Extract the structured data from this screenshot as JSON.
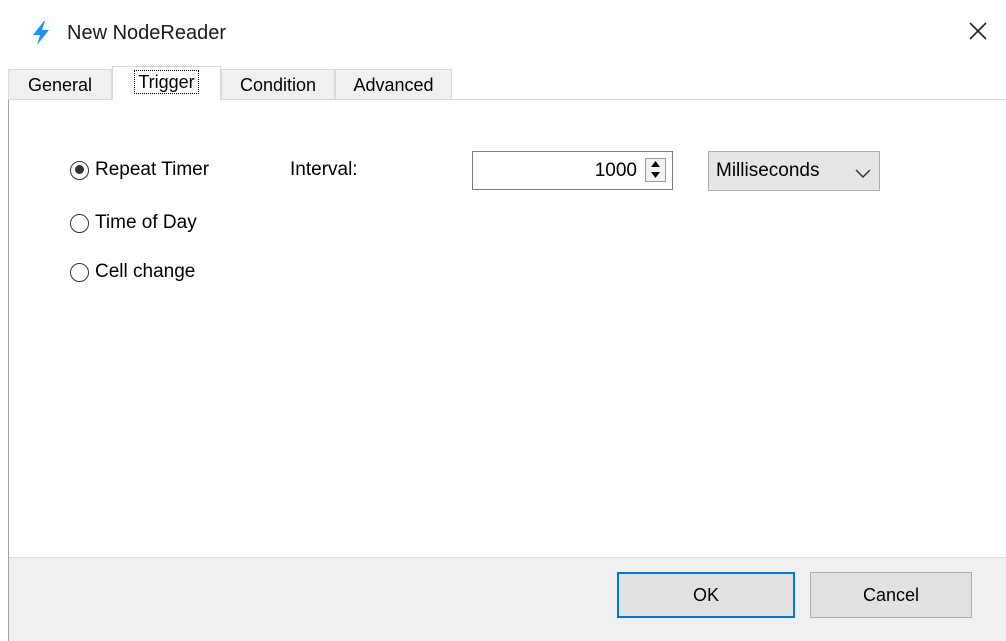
{
  "window": {
    "title": "New NodeReader",
    "icon": "lightning-bolt-icon",
    "close_icon": "close-icon"
  },
  "tabs": [
    {
      "label": "General",
      "active": false
    },
    {
      "label": "Trigger",
      "active": true
    },
    {
      "label": "Condition",
      "active": false
    },
    {
      "label": "Advanced",
      "active": false
    }
  ],
  "trigger": {
    "options": [
      {
        "label": "Repeat Timer",
        "selected": true
      },
      {
        "label": "Time of Day",
        "selected": false
      },
      {
        "label": "Cell change",
        "selected": false
      }
    ],
    "interval_label": "Interval:",
    "interval_value": "1000",
    "unit_selected": "Milliseconds"
  },
  "footer": {
    "ok_label": "OK",
    "cancel_label": "Cancel"
  },
  "colors": {
    "accent": "#0078d7",
    "icon": "#1e90ff",
    "footer_bg": "#f0f0f0",
    "tab_bg": "#f0f0f0",
    "button_bg": "#e1e1e1"
  }
}
